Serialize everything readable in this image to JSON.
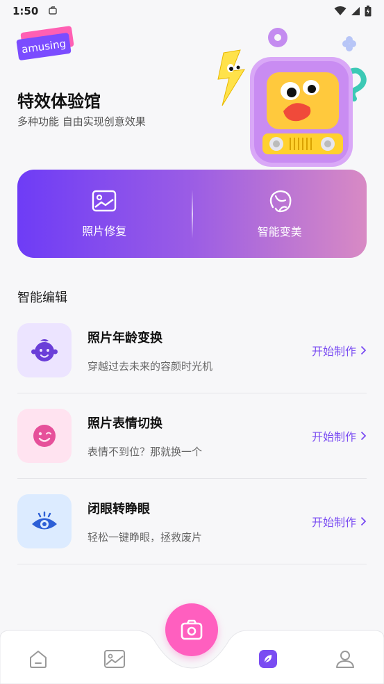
{
  "status_bar": {
    "time": "1:50"
  },
  "brand": {
    "badge_text": "amusing"
  },
  "hero": {
    "title": "特效体验馆",
    "subtitle": "多种功能 自由实现创意效果"
  },
  "banner": {
    "items": [
      {
        "label": "照片修复",
        "icon": "image-icon"
      },
      {
        "label": "智能变美",
        "icon": "face-beauty-icon"
      }
    ]
  },
  "section": {
    "title": "智能编辑"
  },
  "features": [
    {
      "title": "照片年龄变换",
      "desc": "穿越过去未来的容颜时光机",
      "action": "开始制作",
      "icon": "baby-face-icon",
      "bg": "#ece4ff",
      "fg": "#6a3ed8"
    },
    {
      "title": "照片表情切换",
      "desc": "表情不到位？那就换一个",
      "action": "开始制作",
      "icon": "smile-icon",
      "bg": "#ffe3f0",
      "fg": "#e6509a"
    },
    {
      "title": "闭眼转睁眼",
      "desc": "轻松一键睁眼，拯救废片",
      "action": "开始制作",
      "icon": "eye-icon",
      "bg": "#dcebff",
      "fg": "#2d5fd6"
    }
  ],
  "bottom_nav": {
    "items": [
      "home-icon",
      "gallery-icon",
      "effects-icon",
      "profile-icon"
    ],
    "active": "effects-icon",
    "fab_icon": "camera-icon"
  },
  "colors": {
    "accent": "#7a4cf2",
    "fab": "#ff5fbf"
  }
}
